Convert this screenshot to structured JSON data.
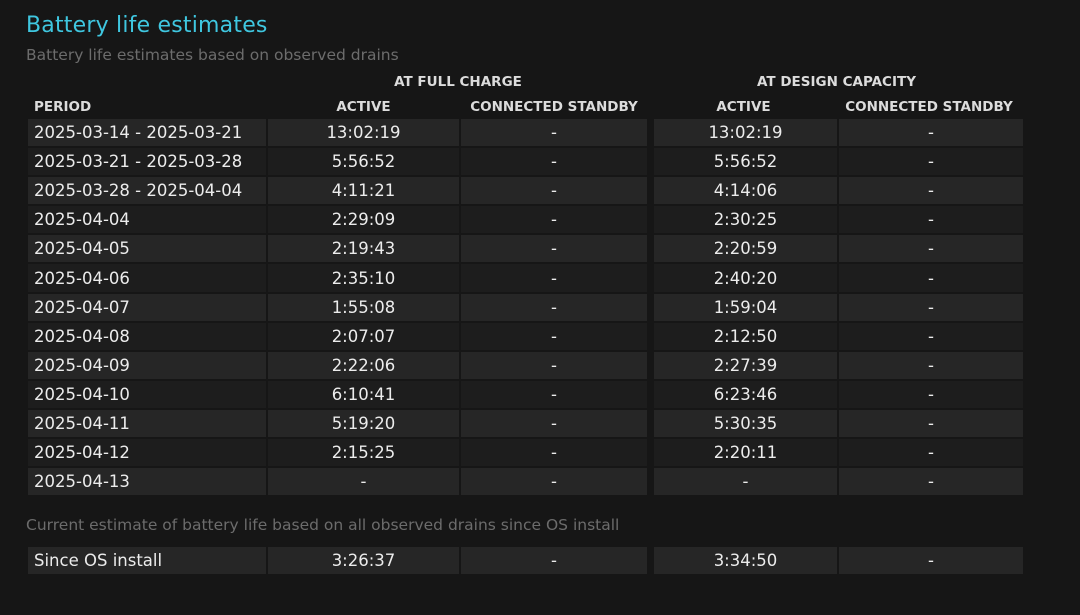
{
  "header": {
    "title": "Battery life estimates",
    "subtitle": "Battery life estimates based on observed drains"
  },
  "table": {
    "group_full": "AT FULL CHARGE",
    "group_design": "AT DESIGN CAPACITY",
    "col_period": "PERIOD",
    "col_active": "ACTIVE",
    "col_standby": "CONNECTED STANDBY",
    "rows": [
      {
        "period": "2025-03-14 - 2025-03-21",
        "full_active": "13:02:19",
        "full_standby": "-",
        "design_active": "13:02:19",
        "design_standby": "-"
      },
      {
        "period": "2025-03-21 - 2025-03-28",
        "full_active": "5:56:52",
        "full_standby": "-",
        "design_active": "5:56:52",
        "design_standby": "-"
      },
      {
        "period": "2025-03-28 - 2025-04-04",
        "full_active": "4:11:21",
        "full_standby": "-",
        "design_active": "4:14:06",
        "design_standby": "-"
      },
      {
        "period": "2025-04-04",
        "full_active": "2:29:09",
        "full_standby": "-",
        "design_active": "2:30:25",
        "design_standby": "-"
      },
      {
        "period": "2025-04-05",
        "full_active": "2:19:43",
        "full_standby": "-",
        "design_active": "2:20:59",
        "design_standby": "-"
      },
      {
        "period": "2025-04-06",
        "full_active": "2:35:10",
        "full_standby": "-",
        "design_active": "2:40:20",
        "design_standby": "-"
      },
      {
        "period": "2025-04-07",
        "full_active": "1:55:08",
        "full_standby": "-",
        "design_active": "1:59:04",
        "design_standby": "-"
      },
      {
        "period": "2025-04-08",
        "full_active": "2:07:07",
        "full_standby": "-",
        "design_active": "2:12:50",
        "design_standby": "-"
      },
      {
        "period": "2025-04-09",
        "full_active": "2:22:06",
        "full_standby": "-",
        "design_active": "2:27:39",
        "design_standby": "-"
      },
      {
        "period": "2025-04-10",
        "full_active": "6:10:41",
        "full_standby": "-",
        "design_active": "6:23:46",
        "design_standby": "-"
      },
      {
        "period": "2025-04-11",
        "full_active": "5:19:20",
        "full_standby": "-",
        "design_active": "5:30:35",
        "design_standby": "-"
      },
      {
        "period": "2025-04-12",
        "full_active": "2:15:25",
        "full_standby": "-",
        "design_active": "2:20:11",
        "design_standby": "-"
      },
      {
        "period": "2025-04-13",
        "full_active": "-",
        "full_standby": "-",
        "design_active": "-",
        "design_standby": "-"
      }
    ]
  },
  "current": {
    "note": "Current estimate of battery life based on all observed drains since OS install",
    "row": {
      "period": "Since OS install",
      "full_active": "3:26:37",
      "full_standby": "-",
      "design_active": "3:34:50",
      "design_standby": "-"
    }
  },
  "colors": {
    "title": "#3fc7e0",
    "row_light": "#262626",
    "row_dark": "#1d1d1d",
    "background": "#161616"
  }
}
